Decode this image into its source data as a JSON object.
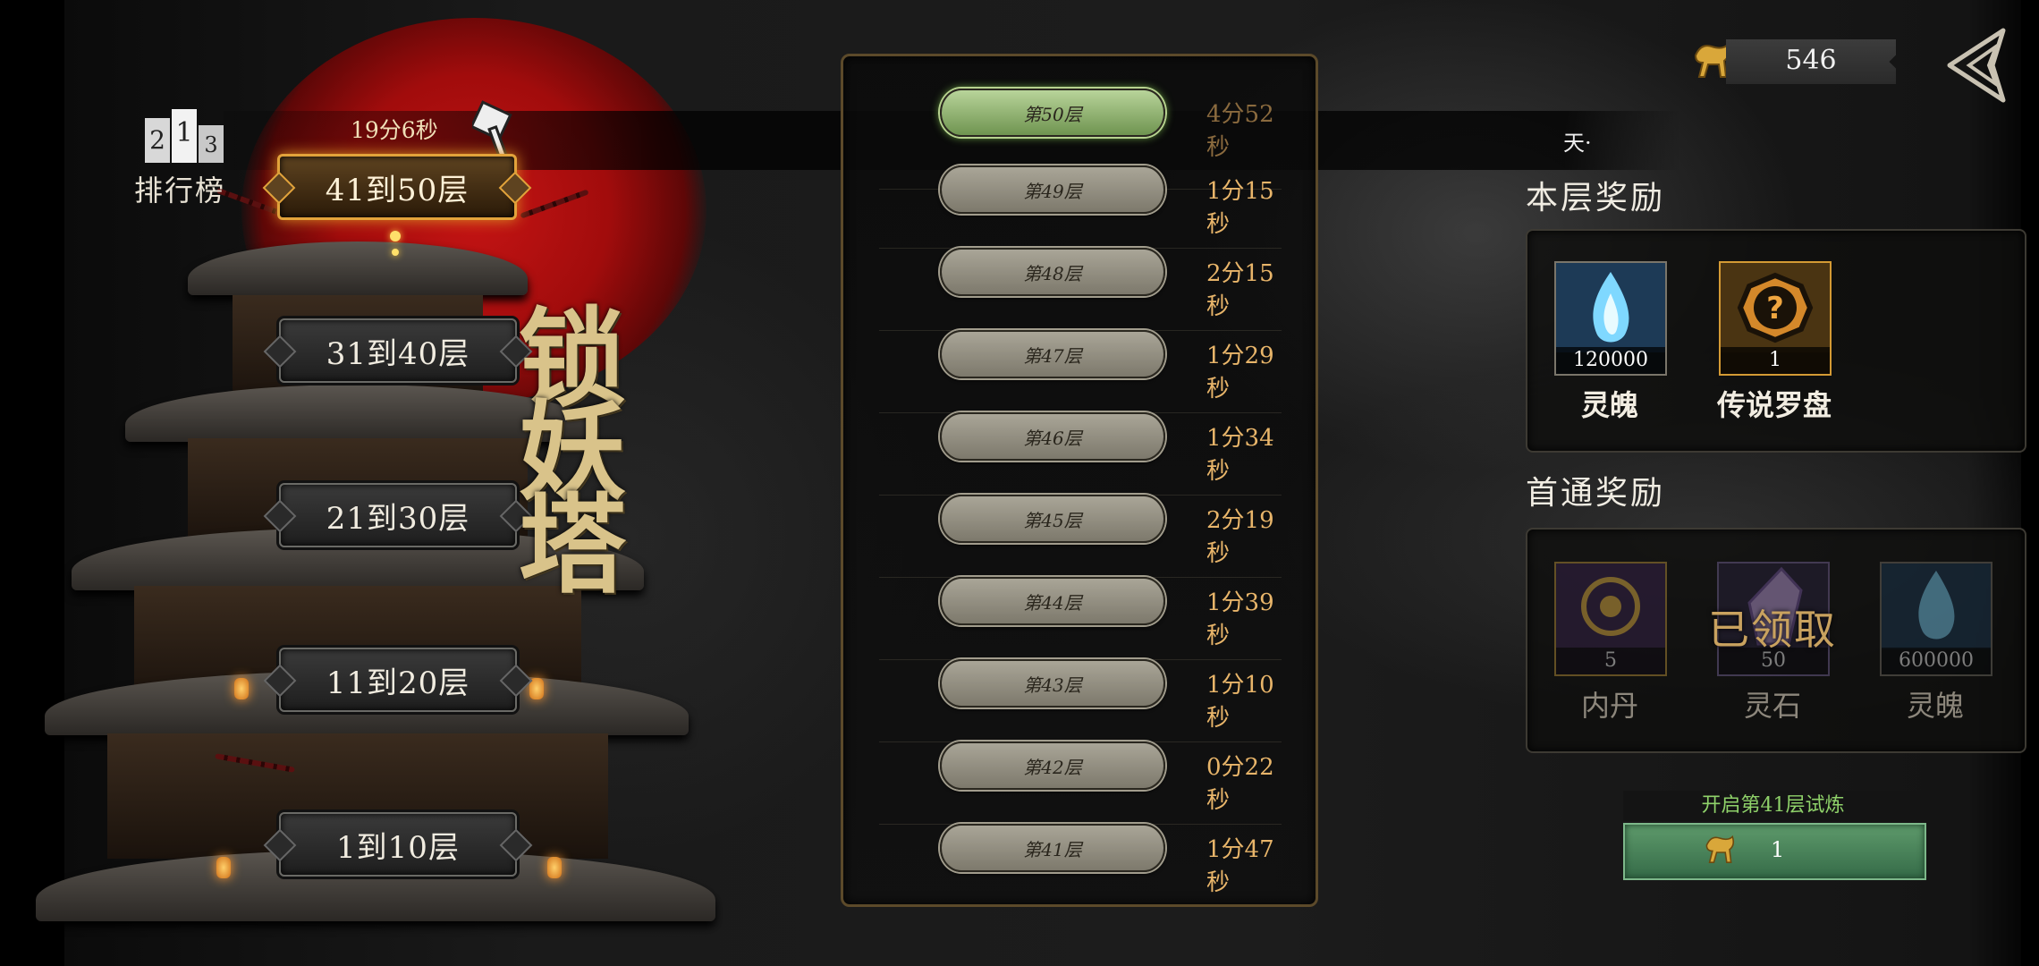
{
  "timer": "19分6秒",
  "leaderboard": {
    "label": "排行榜",
    "digits": [
      "2",
      "1",
      "3"
    ]
  },
  "banner_text": "天·",
  "tower_title": [
    "锁",
    "妖",
    "塔"
  ],
  "floor_groups": [
    {
      "label": "41到50层",
      "active": true
    },
    {
      "label": "31到40层",
      "active": false
    },
    {
      "label": "21到30层",
      "active": false
    },
    {
      "label": "11到20层",
      "active": false
    },
    {
      "label": "1到10层",
      "active": false
    }
  ],
  "floors": [
    {
      "label": "第50层",
      "time": "4分52秒",
      "active": true
    },
    {
      "label": "第49层",
      "time": "1分15秒",
      "active": false
    },
    {
      "label": "第48层",
      "time": "2分15秒",
      "active": false
    },
    {
      "label": "第47层",
      "time": "1分29秒",
      "active": false
    },
    {
      "label": "第46层",
      "time": "1分34秒",
      "active": false
    },
    {
      "label": "第45层",
      "time": "2分19秒",
      "active": false
    },
    {
      "label": "第44层",
      "time": "1分39秒",
      "active": false
    },
    {
      "label": "第43层",
      "time": "1分10秒",
      "active": false
    },
    {
      "label": "第42层",
      "time": "0分22秒",
      "active": false
    },
    {
      "label": "第41层",
      "time": "1分47秒",
      "active": false
    }
  ],
  "currency": {
    "value": "546",
    "icon": "golden-beast-icon"
  },
  "floor_rewards": {
    "title": "本层奖励",
    "items": [
      {
        "name": "灵魄",
        "count": "120000",
        "icon": "blue-soul-flame-icon"
      },
      {
        "name": "传说罗盘",
        "count": "1",
        "icon": "question-mark-compass-icon"
      }
    ]
  },
  "first_clear_rewards": {
    "title": "首通奖励",
    "claimed_label": "已领取",
    "items": [
      {
        "name": "内丹",
        "count": "5",
        "icon": "golden-orb-icon"
      },
      {
        "name": "灵石",
        "count": "50",
        "icon": "spirit-crystal-icon"
      },
      {
        "name": "灵魄",
        "count": "600000",
        "icon": "blue-soul-flame-icon"
      }
    ]
  },
  "trial": {
    "label": "开启第41层试炼",
    "cost": "1"
  },
  "colors": {
    "accent_gold": "#e2a33b",
    "active_green": "#7fbf4f",
    "time_text": "#e8b56a",
    "trial_green": "#5e9a6b"
  }
}
